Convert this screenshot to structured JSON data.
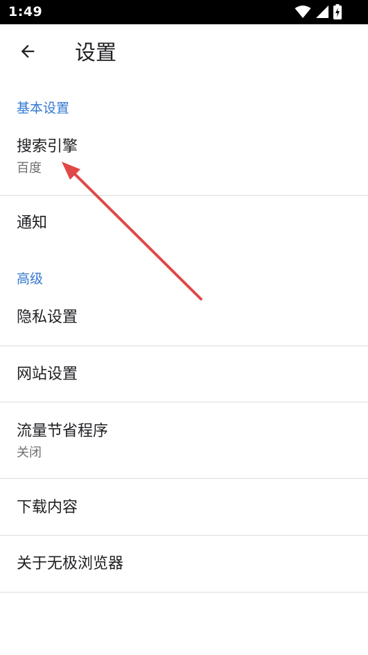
{
  "status_bar": {
    "time": "1:49",
    "icons": [
      "wifi-icon",
      "cell-signal-icon",
      "battery-charging-icon"
    ]
  },
  "toolbar": {
    "back_icon": "arrow-left-icon",
    "title": "设置"
  },
  "sections": {
    "basic": {
      "header": "基本设置",
      "search_engine": {
        "title": "搜索引擎",
        "summary": "百度"
      },
      "notifications": {
        "title": "通知"
      }
    },
    "advanced": {
      "header": "高级",
      "privacy": {
        "title": "隐私设置"
      },
      "site_settings": {
        "title": "网站设置"
      },
      "data_saver": {
        "title": "流量节省程序",
        "summary": "关闭"
      },
      "downloads": {
        "title": "下载内容"
      },
      "about": {
        "title": "关于无极浏览器"
      }
    }
  },
  "colors": {
    "accent": "#3478d0",
    "annotation": "#e04848",
    "divider": "#dcdcdc",
    "status_bar": "#000000"
  }
}
